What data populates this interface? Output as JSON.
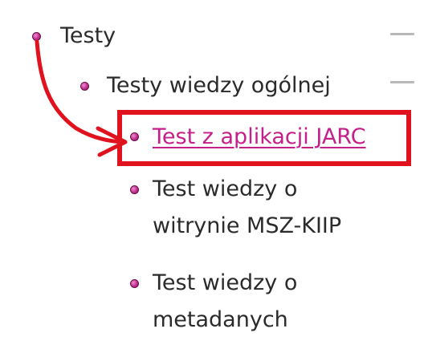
{
  "tree": {
    "root": {
      "label": "Testy"
    },
    "child": {
      "label": "Testy wiedzy ogólnej"
    },
    "items": [
      {
        "line1": "Test z aplikacji JARC",
        "line2": ""
      },
      {
        "line1": "Test wiedzy o",
        "line2": "witrynie MSZ-KIIP"
      },
      {
        "line1": "Test wiedzy o",
        "line2": "metadanych"
      }
    ]
  },
  "colors": {
    "bullet": "#c0308f",
    "link": "#c4208a",
    "annotation": "#e0121e",
    "text": "#2b2b2b"
  }
}
